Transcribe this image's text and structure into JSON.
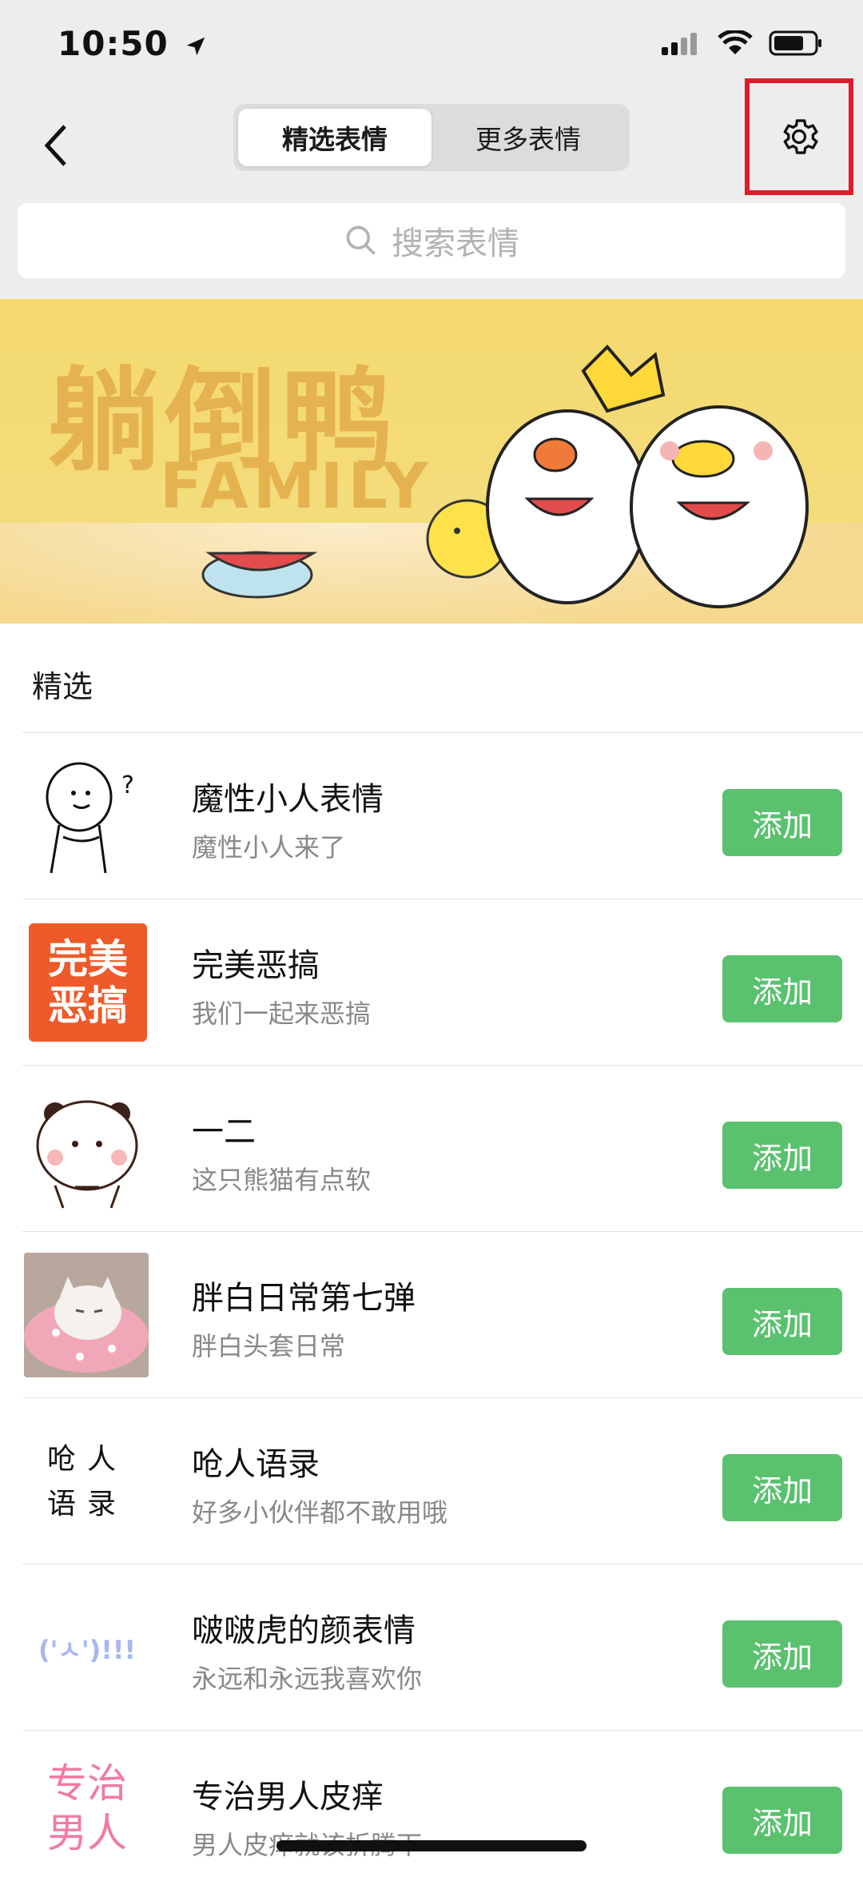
{
  "status": {
    "time": "10:50"
  },
  "nav": {
    "tabs": [
      {
        "label": "精选表情",
        "active": true
      },
      {
        "label": "更多表情",
        "active": false
      }
    ]
  },
  "search": {
    "placeholder": "搜索表情"
  },
  "banner": {
    "title": "躺倒鸭",
    "subtitle": "FAMILY"
  },
  "section": {
    "title": "精选"
  },
  "items": [
    {
      "title": "魔性小人表情",
      "subtitle": "魔性小人来了",
      "button": "添加"
    },
    {
      "title": "完美恶搞",
      "subtitle": "我们一起来恶搞",
      "button": "添加",
      "thumb_text": "完美恶搞"
    },
    {
      "title": "一二",
      "subtitle": "这只熊猫有点软",
      "button": "添加"
    },
    {
      "title": "胖白日常第七弹",
      "subtitle": "胖白头套日常",
      "button": "添加"
    },
    {
      "title": "呛人语录",
      "subtitle": "好多小伙伴都不敢用哦",
      "button": "添加",
      "thumb_text": "呛人语录"
    },
    {
      "title": "啵啵虎的颜表情",
      "subtitle": "永远和永远我喜欢你",
      "button": "添加",
      "thumb_text": "('ㅅ')!!!"
    },
    {
      "title": "专治男人皮痒",
      "subtitle": "男人皮痒就该折腾下",
      "button": "添加",
      "thumb_text": "专治男人"
    }
  ],
  "colors": {
    "accent": "#5ac16e",
    "highlight": "#e21a2a",
    "banner": "#f5d96e"
  }
}
